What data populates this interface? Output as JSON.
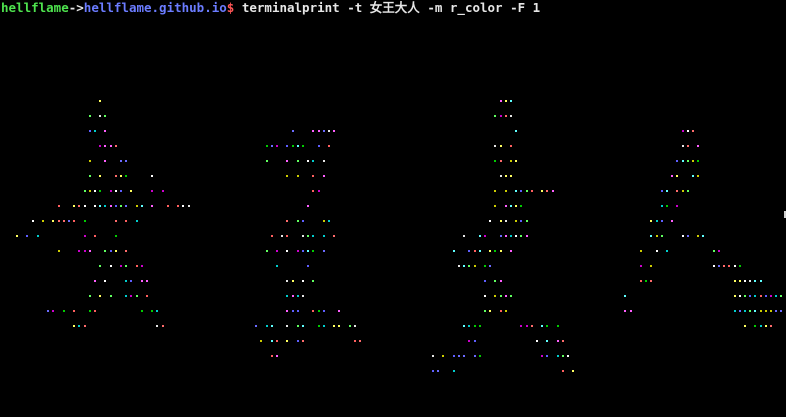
{
  "terminal": {
    "prompt": {
      "user": "hellflame",
      "separator": "->",
      "host": "hellflame.github.io",
      "symbol": "$",
      "command": " terminalprint -t 女王大人 -m r_color -F 1"
    },
    "art": {
      "characters": [
        "女",
        "王",
        "大",
        "人"
      ],
      "mode": "r_color",
      "palette": [
        "#ff5fff",
        "#5f5fff",
        "#5fff5f",
        "#ff5f5f",
        "#ffff5f",
        "#5fffff",
        "#ffffff",
        "#00cd00",
        "#cd00cd",
        "#00cdcd",
        "#cdcd00",
        "#6b6bff",
        "#ff6b6b",
        "#e6e6e6"
      ]
    },
    "colors": {
      "background": "#000000",
      "user": "#4ee34e",
      "host": "#6b7cff",
      "dollar": "#ff5555",
      "text": "#e6e6e6"
    }
  }
}
